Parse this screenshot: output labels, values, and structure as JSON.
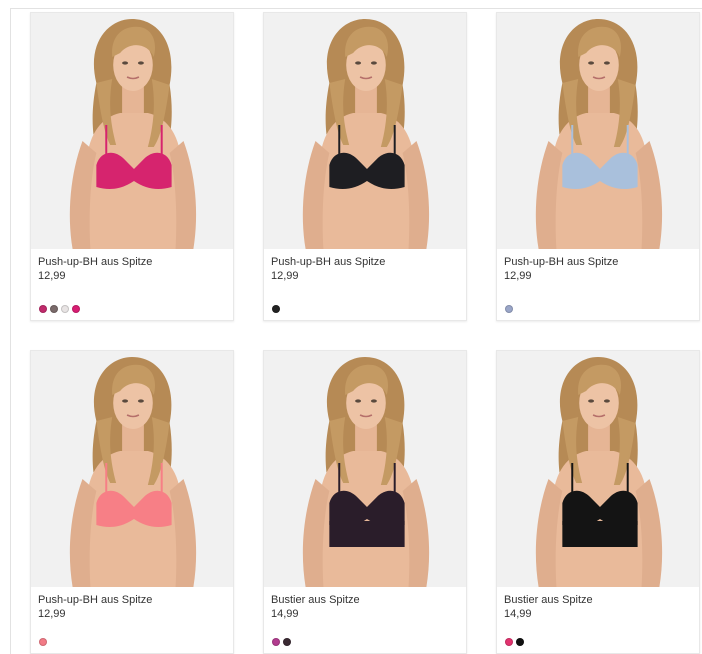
{
  "products": [
    {
      "title": "Push-up-BH aus Spitze",
      "price": "12,99",
      "item_color": "#d6246e",
      "swatches": [
        "#c02a6b",
        "#7a6a6a",
        "#e8e4e4",
        "#d81d72"
      ]
    },
    {
      "title": "Push-up-BH aus Spitze",
      "price": "12,99",
      "item_color": "#1e1e22",
      "swatches": [
        "#222222"
      ]
    },
    {
      "title": "Push-up-BH aus Spitze",
      "price": "12,99",
      "item_color": "#a9c0dc",
      "swatches": [
        "#9aa6c8"
      ]
    },
    {
      "title": "Push-up-BH aus Spitze",
      "price": "12,99",
      "item_color": "#f77f86",
      "swatches": [
        "#f27b86"
      ]
    },
    {
      "title": "Bustier aus Spitze",
      "price": "14,99",
      "item_color": "#2a1d2a",
      "swatches": [
        "#b23c8f",
        "#3a2a33"
      ]
    },
    {
      "title": "Bustier aus Spitze",
      "price": "14,99",
      "item_color": "#141414",
      "swatches": [
        "#e2336f",
        "#111111"
      ]
    }
  ]
}
